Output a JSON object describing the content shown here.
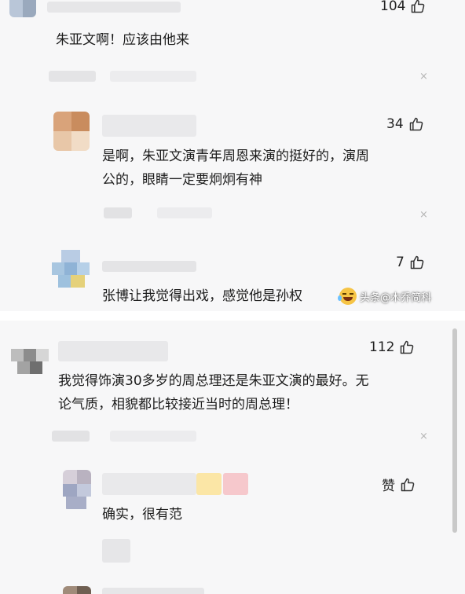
{
  "comments": [
    {
      "likes": "104",
      "text": "朱亚文啊！应该由他来"
    },
    {
      "likes": "34",
      "text_line1": "是啊，朱亚文演青年周恩来演的挺好的，演周",
      "text_line2": "公的，眼睛一定要炯炯有神"
    },
    {
      "likes": "7",
      "text": "张博让我觉得出戏，感觉他是孙权"
    },
    {
      "likes": "112",
      "text_line1": "我觉得饰演30多岁的周总理还是朱亚文演的最好。无",
      "text_line2": "论气质，相貌都比较接近当时的周总理！"
    },
    {
      "likes": "赞",
      "text": "确实，很有范"
    }
  ],
  "watermark": "头条@木乔简科",
  "close_glyph": "×",
  "icons": {
    "like": "thumbs-up-icon",
    "close": "close-icon",
    "emoji": "laughing-emoji-icon"
  }
}
